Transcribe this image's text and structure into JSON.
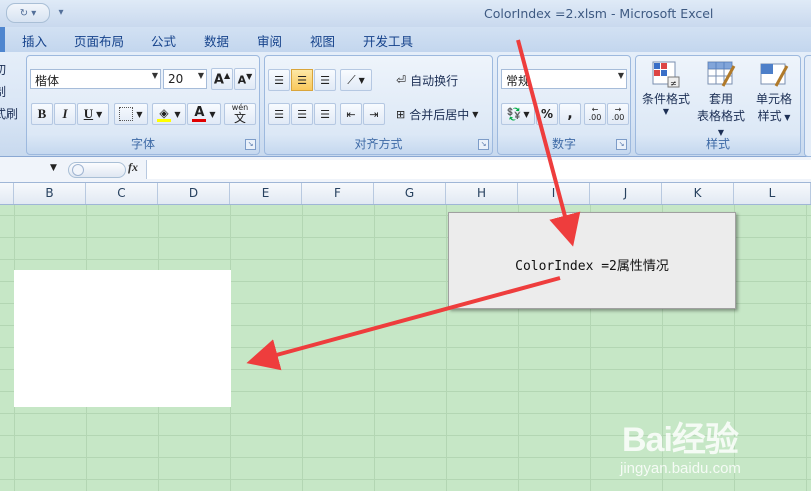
{
  "window": {
    "title": "ColorIndex =2.xlsm - Microsoft Excel",
    "qat_redo_icon": "redo-icon",
    "qat_customize_icon": "customize-qat-icon"
  },
  "tabs": [
    "插入",
    "页面布局",
    "公式",
    "数据",
    "审阅",
    "视图",
    "开发工具"
  ],
  "clipboard_partial": [
    "切",
    "制",
    "式刷"
  ],
  "font_group": {
    "label": "字体",
    "font_name": "楷体",
    "font_size": "20",
    "grow_icon": "A",
    "shrink_icon": "A",
    "bold": "B",
    "italic": "I",
    "underline": "U",
    "font_color_letter": "A",
    "phonetic_top": "wén",
    "phonetic_bottom": "文"
  },
  "alignment_group": {
    "label": "对齐方式",
    "wrap_text": "自动换行",
    "merge_center": "合并后居中"
  },
  "number_group": {
    "label": "数字",
    "format": "常规",
    "percent": "%",
    "comma": ",",
    "inc_decimal": ".00",
    "dec_decimal": ".00"
  },
  "styles_group": {
    "label": "样式",
    "conditional_format": "条件格式",
    "table_format_line1": "套用",
    "table_format_line2": "表格格式",
    "cell_styles_line1": "单元格",
    "cell_styles_line2": "样式"
  },
  "formula_bar": {
    "fx": "fx"
  },
  "columns": [
    "B",
    "C",
    "D",
    "E",
    "F",
    "G",
    "H",
    "I",
    "J",
    "K",
    "L"
  ],
  "dialog": {
    "message": "ColorIndex =2属性情况"
  },
  "watermark": {
    "brand": "Bai经验",
    "url": "jingyan.baidu.com"
  },
  "colors": {
    "sheet_fill": "#c6e7c6",
    "arrow": "#ee3d3d",
    "white_cell_range": "#ffffff"
  }
}
